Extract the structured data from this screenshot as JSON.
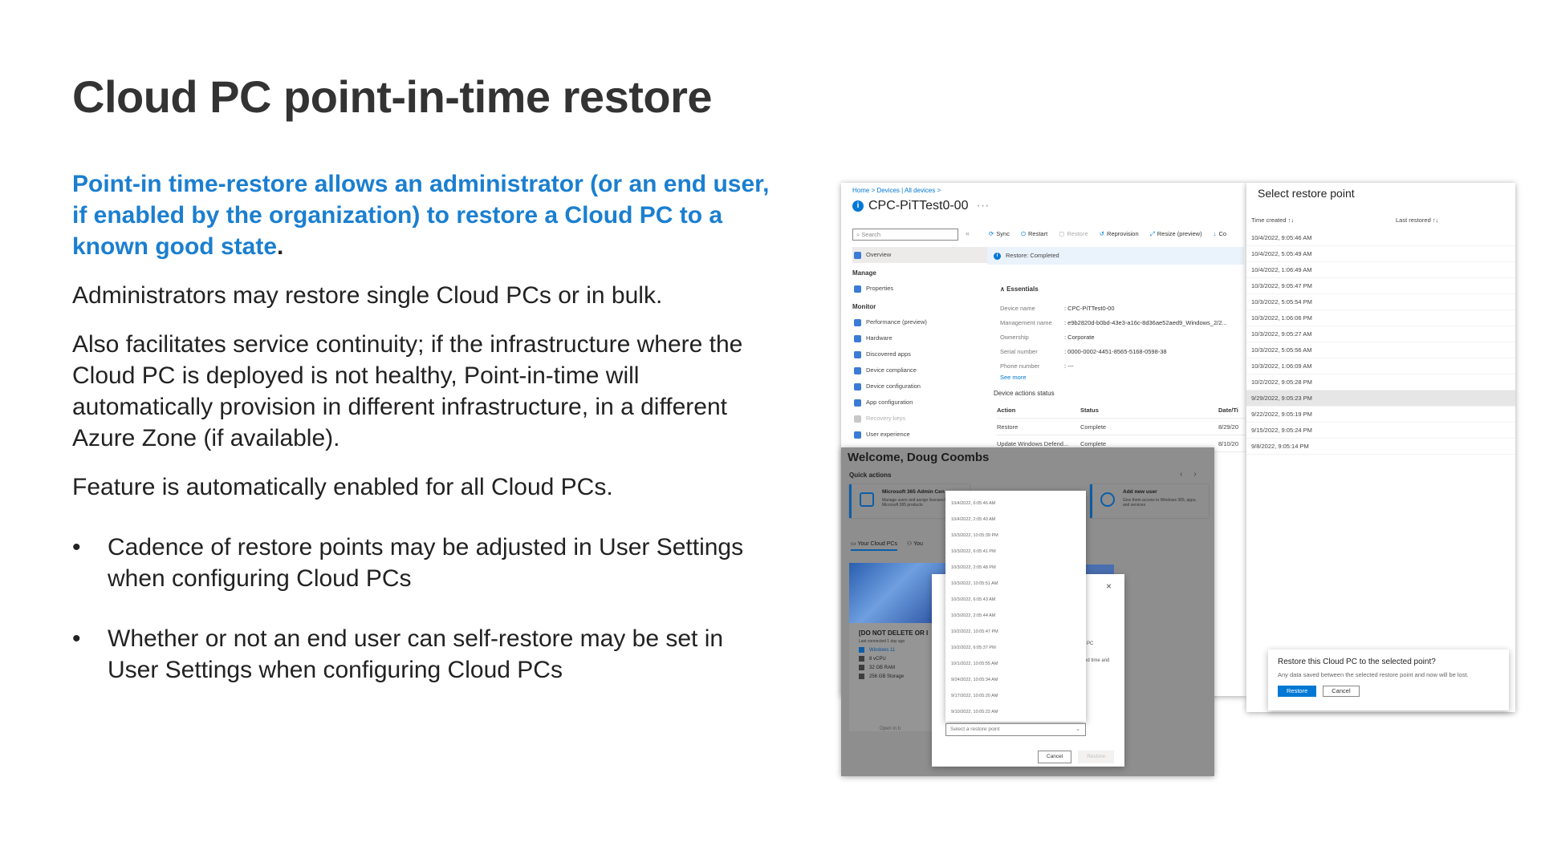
{
  "slide": {
    "title": "Cloud PC point-in-time restore",
    "lead": "Point-in time-restore allows an administrator (or an end user, if enabled by the organization) to restore a Cloud PC to a known good state",
    "lead_end": ".",
    "p1": "Administrators may restore single Cloud PCs or in bulk.",
    "p2": "Also facilitates service continuity; if the infrastructure where the Cloud PC is deployed is not healthy, Point-in-time will automatically provision in different infrastructure, in a different Azure Zone (if available).",
    "p3": "Feature is automatically enabled for all Cloud PCs.",
    "bullets": [
      "Cadence of restore points may be adjusted in User Settings when configuring Cloud PCs",
      "Whether or not an end user can self-restore may be set in User Settings when configuring Cloud PCs"
    ]
  },
  "intune": {
    "breadcrumb": "Home  >  Devices | All devices  >",
    "device_title": "CPC-PiTTest0-00",
    "ellipsis": "···",
    "search_placeholder": "Search",
    "search_clear": "«",
    "nav": {
      "overview": "Overview",
      "manage_header": "Manage",
      "properties": "Properties",
      "monitor_header": "Monitor",
      "monitor_items": [
        "Performance (preview)",
        "Hardware",
        "Discovered apps",
        "Device compliance",
        "Device configuration",
        "App configuration",
        "Recovery keys",
        "User experience"
      ]
    },
    "toolbar": [
      "Sync",
      "Restart",
      "Restore",
      "Reprovision",
      "Resize (preview)",
      "Co"
    ],
    "banner": "Restore: Completed",
    "essentials_header": "Essentials",
    "essentials": [
      {
        "k": "Device name",
        "v": ": CPC-PiTTest0-00"
      },
      {
        "k": "Management name",
        "v": ": e9b2820d-b0bd-43e3-a16c-8d36ae52aed9_Windows_2/2..."
      },
      {
        "k": "Ownership",
        "v": ": Corporate"
      },
      {
        "k": "Serial number",
        "v": ": 0000-0002-4451-8565-5168-0598-38"
      },
      {
        "k": "Phone number",
        "v": ": ---"
      }
    ],
    "see_more": "See more",
    "actions_status_label": "Device actions status",
    "actions_header": {
      "action": "Action",
      "status": "Status",
      "date": "Date/Ti"
    },
    "actions_rows": [
      {
        "action": "Restore",
        "status": "Complete",
        "date": "8/29/20"
      },
      {
        "action": "Update Windows Defend...",
        "status": "Complete",
        "date": "8/10/20"
      }
    ]
  },
  "restore_points": {
    "title": "Select restore point",
    "col_time": "Time created",
    "col_last": "Last restored",
    "sort_icon": "↑↓",
    "items": [
      "10/4/2022, 9:05:46 AM",
      "10/4/2022, 5:05:49 AM",
      "10/4/2022, 1:06:49 AM",
      "10/3/2022, 9:05:47 PM",
      "10/3/2022, 5:05:54 PM",
      "10/3/2022, 1:06:06 PM",
      "10/3/2022, 9:05:27 AM",
      "10/3/2022, 5:05:56 AM",
      "10/3/2022, 1:06:09 AM",
      "10/2/2022, 9:05:28 PM",
      "9/29/2022, 9:05:23 PM",
      "9/22/2022, 9:05:19 PM",
      "9/15/2022, 9:05:24 PM",
      "9/8/2022, 9:05:14 PM"
    ],
    "selected_index": 10,
    "confirm": {
      "question": "Restore this Cloud PC to the selected point?",
      "subtext": "Any data saved between the selected restore point and now will be lost.",
      "restore_label": "Restore",
      "cancel_label": "Cancel"
    }
  },
  "portal": {
    "welcome": "Welcome, Doug Coombs",
    "quick_actions": "Quick actions",
    "prev_arrow": "‹",
    "next_arrow": "›",
    "card1_title": "Microsoft 365 Admin Cen",
    "card1_sub": "Manage users and assign licenses to Microsoft 365 products",
    "card2_title": "Add new user",
    "card2_sub": "Give them access to Windows 365, apps, and services",
    "tab1": "Your Cloud PCs",
    "tab2": "You",
    "pc_name": "[DO NOT DELETE OR I",
    "pc_last": "Last connected 1 day ago",
    "pc_specs": [
      "Windows 11",
      "8 vCPU",
      "32 GB RAM",
      "256 GB Storage"
    ],
    "open_in": "Open in b",
    "dialog_close": "×",
    "dialog_frag1": "]",
    "dialog_frag2": "g",
    "dialog_frag3": "l PC",
    "dialog_frag4": "ed time and",
    "dropdown_items": [
      "10/4/2022, 6:05:46 AM",
      "10/4/2022, 2:05:40 AM",
      "10/3/2022, 10:05:39 PM",
      "10/3/2022, 6:05:41 PM",
      "10/3/2022, 2:05:48 PM",
      "10/3/2022, 10:05:51 AM",
      "10/3/2022, 6:05:43 AM",
      "10/3/2022, 2:05:44 AM",
      "10/2/2022, 10:05:47 PM",
      "10/2/2022, 6:05:37 PM",
      "10/1/2022, 10:05:55 AM",
      "9/24/2022, 10:05:34 AM",
      "9/17/2022, 10:05:20 AM",
      "9/10/2022, 10:05:22 AM"
    ],
    "dropdown_placeholder": "Select a restore point",
    "cancel_label": "Cancel",
    "restore_label": "Restore"
  },
  "colors": {
    "accent": "#1b7fd0",
    "azure_blue": "#0078d4",
    "portal_overlay": "#8e8e8e"
  },
  "icons": [
    "info-icon",
    "sync-icon",
    "restart-icon",
    "restore-icon",
    "reprovision-icon",
    "resize-icon",
    "chevron-up-icon",
    "sort-icon",
    "close-icon",
    "chevron-down-icon",
    "windows-icon"
  ]
}
